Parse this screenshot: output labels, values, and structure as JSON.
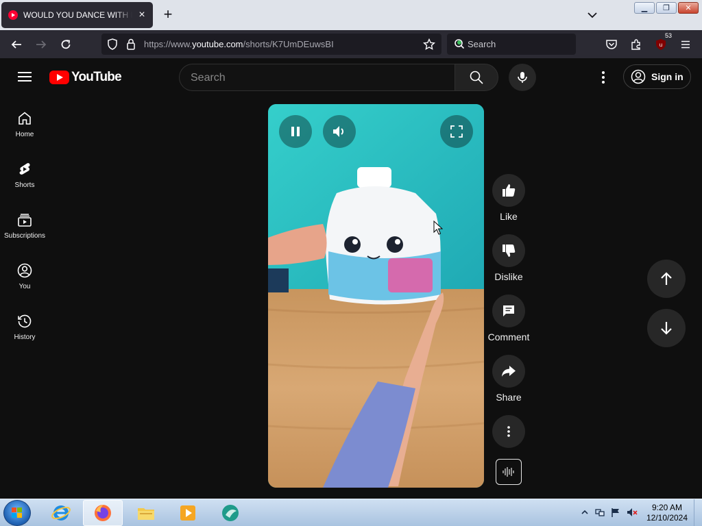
{
  "browser": {
    "tab": {
      "title": "WOULD YOU DANCE WITH FOX",
      "favicon": "youtube-icon"
    },
    "url": {
      "prefix": "https://www.",
      "domain": "youtube.com",
      "path": "/shorts/K7UmDEuwsBI"
    },
    "search_placeholder": "Search",
    "extensions_badge": "53"
  },
  "youtube": {
    "logo_text": "YouTube",
    "search_placeholder": "Search",
    "signin_label": "Sign in",
    "guide": [
      {
        "label": "Home",
        "icon": "home-icon"
      },
      {
        "label": "Shorts",
        "icon": "shorts-icon"
      },
      {
        "label": "Subscriptions",
        "icon": "subscriptions-icon"
      },
      {
        "label": "You",
        "icon": "you-icon"
      },
      {
        "label": "History",
        "icon": "history-icon"
      }
    ],
    "actions": [
      {
        "label": "Like",
        "icon": "thumbs-up-icon"
      },
      {
        "label": "Dislike",
        "icon": "thumbs-down-icon"
      },
      {
        "label": "Comment",
        "icon": "comment-icon"
      },
      {
        "label": "Share",
        "icon": "share-icon"
      }
    ]
  },
  "taskbar": {
    "time": "9:20 AM",
    "date": "12/10/2024",
    "apps": [
      "internet-explorer-icon",
      "firefox-icon",
      "file-explorer-icon",
      "media-player-icon",
      "app-icon"
    ]
  },
  "colors": {
    "youtube_red": "#ff0000",
    "background": "#0f0f0f",
    "action_bg": "#272727"
  }
}
